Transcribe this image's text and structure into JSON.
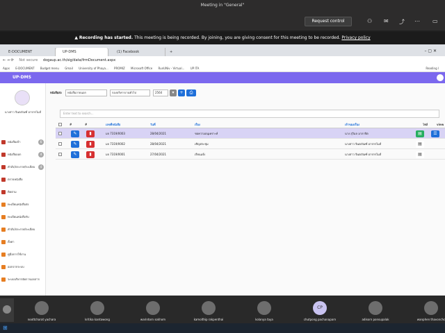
{
  "teams": {
    "title": "Meeting in \"General\"",
    "request_control": "Request control",
    "recording_bold": "Recording has started.",
    "recording_text": "This meeting is being recorded. By joining, you are giving consent for this meeting to be recorded.",
    "privacy_link": "Privacy policy"
  },
  "browser": {
    "tabs": [
      "E-DOCUMENT",
      "UP-DMS",
      "(1) Facebook"
    ],
    "new_tab": "+",
    "url_prefix": "Not secure",
    "url": "dogaup.ac.th/sig/data/frmDocument.aspx",
    "bookmarks": [
      "Apps",
      "E-DOCUMENT",
      "Budget menu",
      "Gmail",
      "University of Phaya...",
      "PROMIZ",
      "Microsoft Office",
      "RunUNiv - Virtual...",
      "UP ITA"
    ],
    "reading_list": "Reading l"
  },
  "app": {
    "brand": "UP-DMS",
    "user": "นางสาว จินตภัณฑ์ อารกรไมส์",
    "sidebar": [
      {
        "label": "หนังสือเข้า",
        "badge": "6"
      },
      {
        "label": "หนังสือออก",
        "badge": "4"
      },
      {
        "label": "คำสั่ง/ประกาศ/ระเบียบ",
        "badge": "4"
      },
      {
        "label": "ตรวจหนังสือ",
        "badge": ""
      },
      {
        "label": "ติดตาม",
        "badge": ""
      },
      {
        "label": "ทะเบียนหนังสือส่ง",
        "badge": ""
      },
      {
        "label": "ทะเบียนหนังสือรับ",
        "badge": ""
      },
      {
        "label": "คำสั่ง/ประกาศ/ระเบียบ",
        "badge": ""
      },
      {
        "label": "ตั้งค่า",
        "badge": ""
      },
      {
        "label": "คู่มือการใช้งาน",
        "badge": ""
      },
      {
        "label": "ออกจากระบบ",
        "badge": ""
      },
      {
        "label": "ระบบบริหารจัดการเอกสาร",
        "badge": ""
      }
    ],
    "filter": {
      "label": "หนังสือส่ง",
      "type": "หนังสือภายนอก",
      "unit": "กองบริหารงานทั่วไป",
      "year": "2564"
    },
    "search_placeholder": "Enter text to search...",
    "columns": [
      "#",
      "#",
      "เลขที่หนังสือ",
      "วันที่",
      "เรื่อง",
      "เจ้าของเรื่อง",
      "ไฟล์",
      "view"
    ],
    "rows": [
      {
        "no": "มจ 7319/0003",
        "date": "28/04/2021",
        "subject": "ขอความอนุเคราะห์",
        "owner": "นาง สุวิมล มาลาจิต"
      },
      {
        "no": "มจ 7319/0002",
        "date": "28/04/2021",
        "subject": "เชิญประชุม",
        "owner": "นางสาว จินตภัณฑ์ อารกรไมส์"
      },
      {
        "no": "มจ 7319/0001",
        "date": "27/04/2021",
        "subject": "เรียนแจ้ง",
        "owner": "นางสาว จินตภัณฑ์ อารกรไมส์"
      }
    ]
  },
  "participants": [
    {
      "initials": "",
      "name": "noottcharat yachara"
    },
    {
      "initials": "",
      "name": "kritika kantawong"
    },
    {
      "initials": "",
      "name": "warintorn sokhom"
    },
    {
      "initials": "",
      "name": "kamolthip rakpenthai"
    },
    {
      "initials": "",
      "name": "kolanya taya"
    },
    {
      "initials": "CP",
      "name": "chutpong pachanaparn"
    },
    {
      "initials": "",
      "name": "adisorn ponsupalak"
    },
    {
      "initials": "",
      "name": "wanphen thavonchc"
    }
  ],
  "colors": {
    "accent": "#7b68ee",
    "edit": "#1e6fd9",
    "delete": "#d63031",
    "file": "#27ae60",
    "view": "#1e6fd9"
  }
}
